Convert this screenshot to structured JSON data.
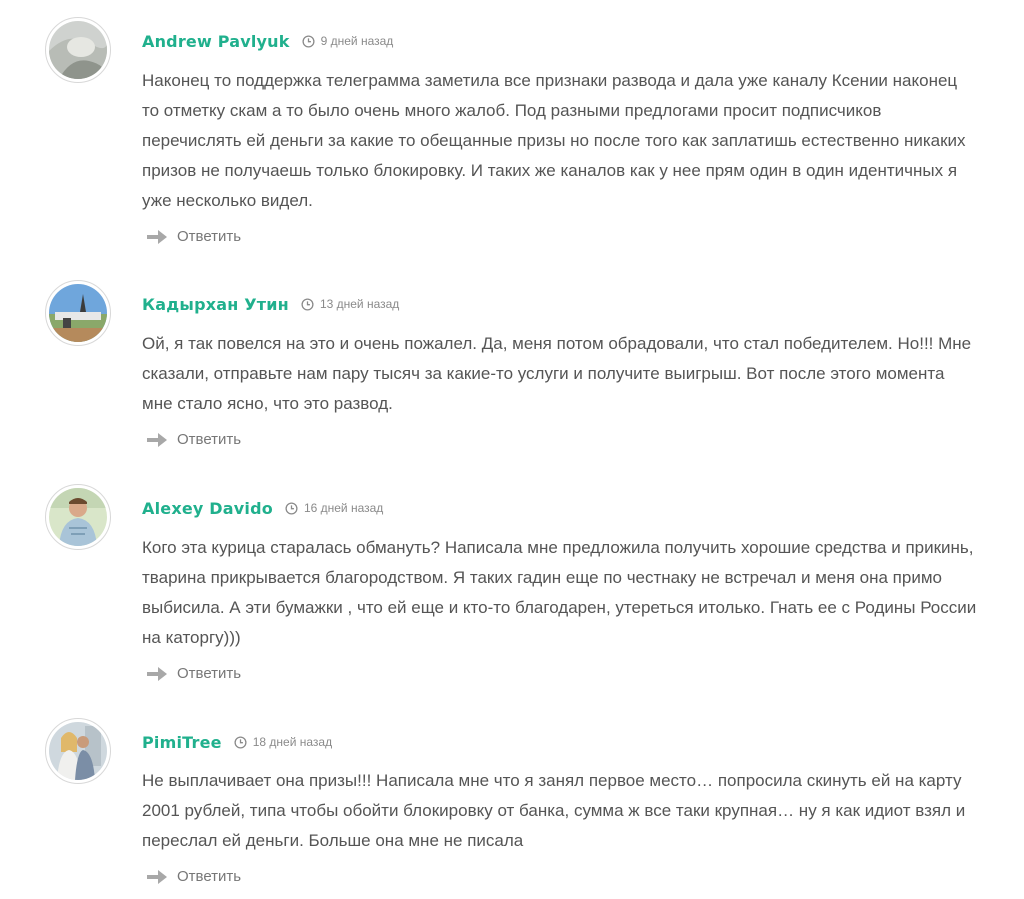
{
  "reply_label": "Ответить",
  "colors": {
    "author": "#20b08d",
    "text": "#555555",
    "meta": "#8a8a8a",
    "reply_icon": "#a8a8a8"
  },
  "icons": {
    "time": "clock-icon",
    "reply": "reply-arrow-icon"
  },
  "comments": [
    {
      "author": "Andrew Pavlyuk",
      "time": "9 дней назад",
      "text": "Наконец то поддержка телеграмма заметила все признаки развода и дала уже каналу Ксении наконец то отметку скам а то было очень много жалоб. Под разными предлогами просит подписчиков перечислять ей деньги за какие то обещанные призы но после того как заплатишь естественно никаких призов не получаешь только блокировку. И таких же каналов как у нее прям один в один идентичных я уже несколько видел."
    },
    {
      "author": "Кадырхан Утин",
      "time": "13 дней назад",
      "text": "Ой, я так повелся на это и очень пожалел. Да, меня потом обрадовали, что стал победителем. Но!!! Мне сказали, отправьте нам пару тысяч за какие-то услуги и получите выигрыш. Вот после этого момента мне стало ясно, что это развод."
    },
    {
      "author": "Alexey Davido",
      "time": "16 дней назад",
      "text": "Кого эта курица старалась обмануть? Написала мне предложила получить хорошие средства и прикинь, тварина прикрывается благородством. Я таких гадин еще по честнаку не встречал и меня она примо выбисила. А эти бумажки , что ей еще и кто-то благодарен, утереться итолько. Гнать ее с Родины России на каторгу)))"
    },
    {
      "author": "PimiTree",
      "time": "18 дней назад",
      "text": "Не выплачивает она призы!!! Написала мне что я занял первое место… попросила скинуть ей на карту 2001 рублей, типа чтобы обойти блокировку от банка, сумма ж все таки крупная… ну я как идиот взял и переслал ей деньги. Больше она мне не писала"
    }
  ]
}
